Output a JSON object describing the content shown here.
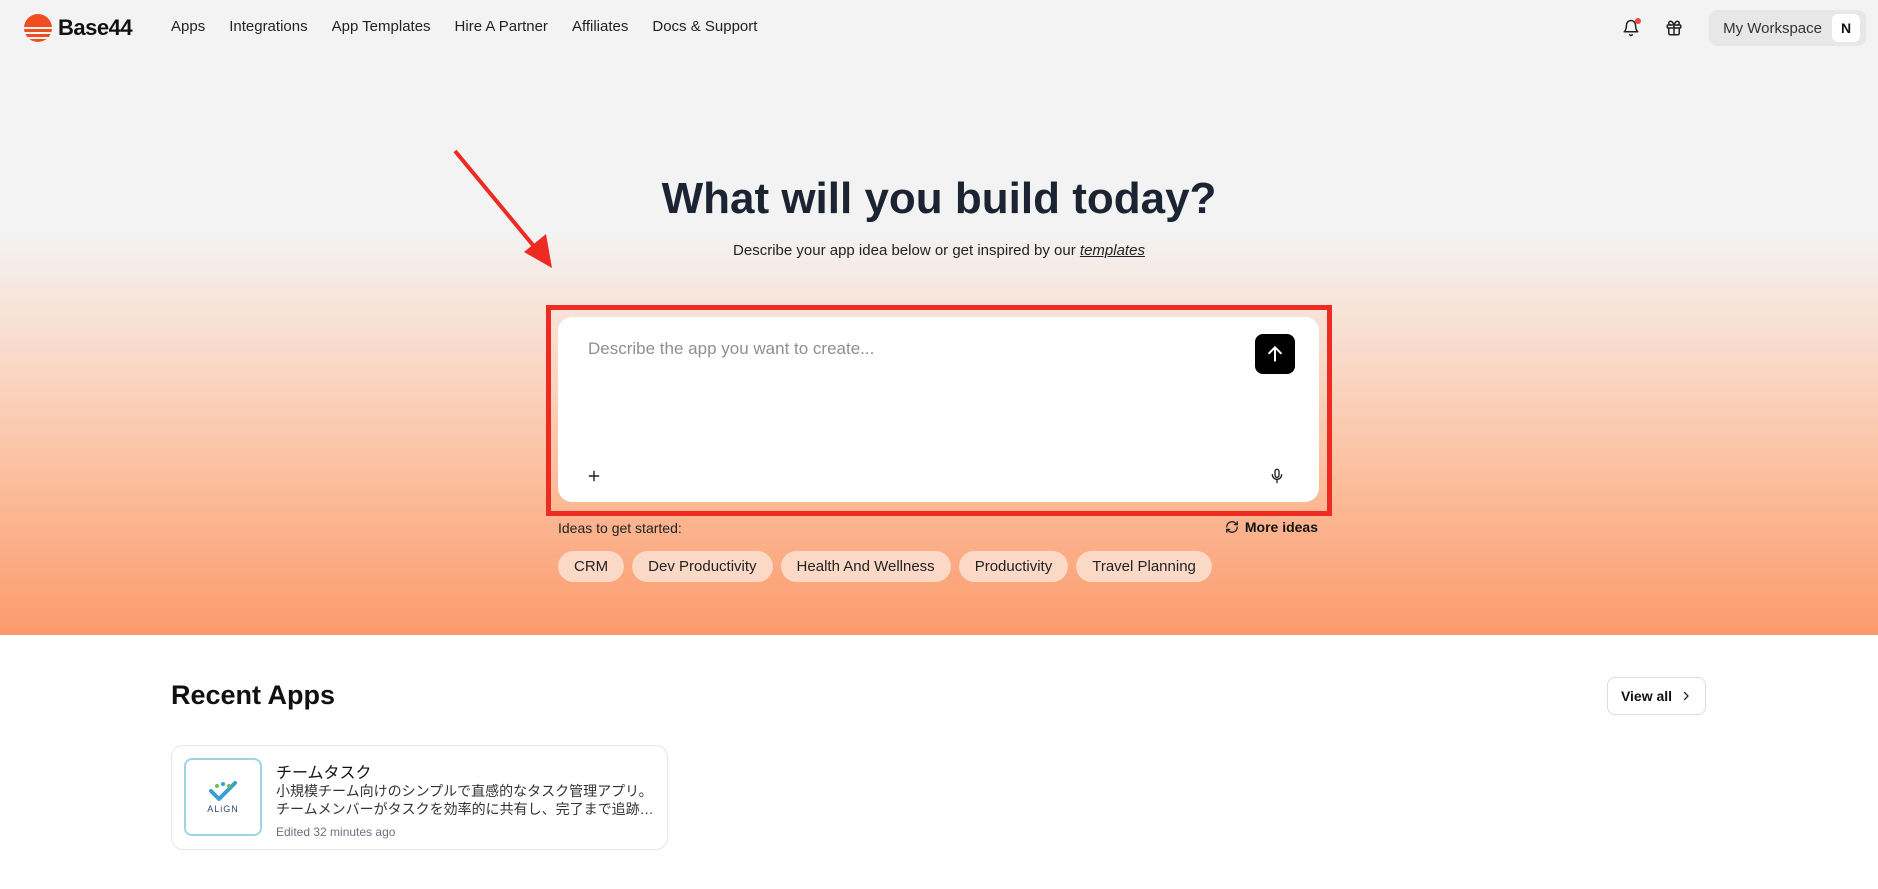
{
  "brand": {
    "name": "Base44",
    "accent": "#f04d21"
  },
  "nav": {
    "items": [
      {
        "label": "Apps"
      },
      {
        "label": "Integrations"
      },
      {
        "label": "App Templates"
      },
      {
        "label": "Hire A Partner"
      },
      {
        "label": "Affiliates"
      },
      {
        "label": "Docs & Support"
      }
    ]
  },
  "header": {
    "notification_icon": "bell-icon",
    "gift_icon": "gift-icon",
    "workspace_label": "My Workspace",
    "avatar_initial": "N"
  },
  "hero": {
    "title": "What will you build today?",
    "subtitle_prefix": "Describe your app idea below or get inspired by our ",
    "subtitle_link": "templates"
  },
  "prompt": {
    "placeholder": "Describe the app you want to create...",
    "value": "",
    "send_icon": "arrow-up-icon",
    "attach_icon": "plus-icon",
    "mic_icon": "microphone-icon",
    "highlight_color": "#ee2b22"
  },
  "ideas": {
    "label": "Ideas to get started:",
    "more_label": "More ideas",
    "chips": [
      {
        "label": "CRM"
      },
      {
        "label": "Dev Productivity"
      },
      {
        "label": "Health And Wellness"
      },
      {
        "label": "Productivity"
      },
      {
        "label": "Travel Planning"
      }
    ]
  },
  "recent": {
    "title": "Recent Apps",
    "view_all": "View all",
    "apps": [
      {
        "name": "チームタスク",
        "thumb_text": "ALiGN",
        "desc_line1": "小規模チーム向けのシンプルで直感的なタスク管理アプリ。",
        "desc_line2": "チームメンバーがタスクを効率的に共有し、完了まで追跡…",
        "edited": "Edited 32 minutes ago"
      }
    ]
  }
}
